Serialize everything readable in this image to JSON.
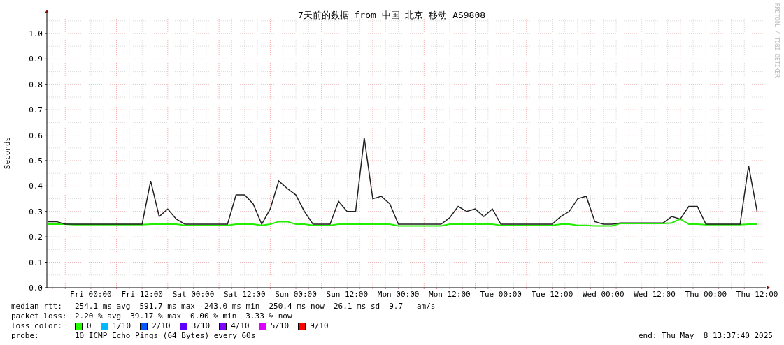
{
  "graph": {
    "credit": "RRDTOOL / TOBI OETIKER",
    "chart_data": {
      "type": "line",
      "title": "7天前的数据 from 中国 北京 移动 AS9808",
      "ylabel": "Seconds",
      "categories": [
        null,
        null,
        null,
        null,
        null,
        "Fri 00:00",
        null,
        null,
        null,
        null,
        null,
        "Fri 12:00",
        null,
        null,
        null,
        null,
        null,
        "Sat 00:00",
        null,
        null,
        null,
        null,
        null,
        "Sat 12:00",
        null,
        null,
        null,
        null,
        null,
        "Sun 00:00",
        null,
        null,
        null,
        null,
        null,
        "Sun 12:00",
        null,
        null,
        null,
        null,
        null,
        "Mon 00:00",
        null,
        null,
        null,
        null,
        null,
        "Mon 12:00",
        null,
        null,
        null,
        null,
        null,
        "Tue 00:00",
        null,
        null,
        null,
        null,
        null,
        "Tue 12:00",
        null,
        null,
        null,
        null,
        null,
        "Wed 00:00",
        null,
        null,
        null,
        null,
        null,
        "Wed 12:00",
        null,
        null,
        null,
        null,
        null,
        "Thu 00:00",
        null,
        null,
        null,
        null,
        null,
        "Thu 12:00"
      ],
      "series": [
        {
          "color": "#22ee00",
          "values": [
            0.25,
            0.25,
            0.25,
            0.248,
            0.248,
            0.248,
            0.248,
            0.248,
            0.248,
            0.248,
            0.248,
            0.248,
            0.25,
            0.25,
            0.25,
            0.25,
            0.245,
            0.245,
            0.245,
            0.245,
            0.245,
            0.245,
            0.25,
            0.25,
            0.25,
            0.245,
            0.25,
            0.26,
            0.26,
            0.25,
            0.25,
            0.245,
            0.245,
            0.245,
            0.25,
            0.25,
            0.25,
            0.25,
            0.25,
            0.25,
            0.25,
            0.243,
            0.243,
            0.243,
            0.243,
            0.243,
            0.243,
            0.25,
            0.25,
            0.25,
            0.25,
            0.25,
            0.25,
            0.245,
            0.245,
            0.245,
            0.245,
            0.245,
            0.245,
            0.245,
            0.25,
            0.25,
            0.245,
            0.245,
            0.243,
            0.243,
            0.243,
            0.253,
            0.253,
            0.253,
            0.253,
            0.253,
            0.253,
            0.255,
            0.27,
            0.25,
            0.25,
            0.248,
            0.248,
            0.248,
            0.248,
            0.248,
            0.25,
            0.25
          ]
        },
        {
          "color": "#202020",
          "values": [
            0.26,
            0.26,
            0.25,
            0.25,
            0.25,
            0.25,
            0.25,
            0.25,
            0.25,
            0.25,
            0.25,
            0.25,
            0.42,
            0.28,
            0.31,
            0.27,
            0.25,
            0.25,
            0.25,
            0.25,
            0.25,
            0.25,
            0.365,
            0.365,
            0.33,
            0.25,
            0.31,
            0.42,
            0.39,
            0.365,
            0.3,
            0.25,
            0.25,
            0.25,
            0.34,
            0.3,
            0.3,
            0.59,
            0.35,
            0.36,
            0.33,
            0.25,
            0.25,
            0.25,
            0.25,
            0.25,
            0.25,
            0.275,
            0.32,
            0.3,
            0.31,
            0.28,
            0.31,
            0.25,
            0.25,
            0.25,
            0.25,
            0.25,
            0.25,
            0.25,
            0.28,
            0.3,
            0.35,
            0.36,
            0.26,
            0.25,
            0.25,
            0.255,
            0.255,
            0.255,
            0.255,
            0.255,
            0.255,
            0.28,
            0.27,
            0.32,
            0.32,
            0.25,
            0.25,
            0.25,
            0.25,
            0.25,
            0.48,
            0.3
          ]
        }
      ],
      "ylim": [
        0,
        1.08
      ],
      "grid": true,
      "yticks": [
        {
          "value": 0,
          "label": "0.0"
        },
        {
          "value": 0.1,
          "label": "0.1"
        },
        {
          "value": 0.2,
          "label": "0.2"
        },
        {
          "value": 0.3,
          "label": "0.3"
        },
        {
          "value": 0.4,
          "label": "0.4"
        },
        {
          "value": 0.5,
          "label": "0.5"
        },
        {
          "value": 0.6,
          "label": "0.6"
        },
        {
          "value": 0.7,
          "label": "0.7"
        },
        {
          "value": 0.8,
          "label": "0.8"
        },
        {
          "value": 0.9,
          "label": "0.9"
        },
        {
          "value": 1.0,
          "label": "1.0"
        }
      ]
    }
  },
  "median_rtt": {
    "label": "median rtt:",
    "values": [
      "254.1 ms avg",
      "591.7 ms max",
      "243.0 ms min",
      "250.4 ms now",
      "26.1 ms sd",
      "9.7   am/s"
    ]
  },
  "packet_loss": {
    "label": "packet loss:",
    "values": [
      "2.20 % avg",
      "39.17 % max",
      "0.00 % min",
      "3.33 % now"
    ]
  },
  "loss_color": {
    "label": "loss color:",
    "items": [
      {
        "label": "0",
        "color": "#26ff00"
      },
      {
        "label": "1/10",
        "color": "#00b8ff"
      },
      {
        "label": "2/10",
        "color": "#0059ff"
      },
      {
        "label": "3/10",
        "color": "#5e00ff"
      },
      {
        "label": "4/10",
        "color": "#7e00ff"
      },
      {
        "label": "5/10",
        "color": "#dd00ff"
      },
      {
        "label": "9/10",
        "color": "#ff0000"
      }
    ]
  },
  "probe": {
    "label": "probe:",
    "text": "10 ICMP Echo Pings (64 Bytes) every 60s"
  },
  "end": "end: Thu May  8 13:37:40 2025"
}
